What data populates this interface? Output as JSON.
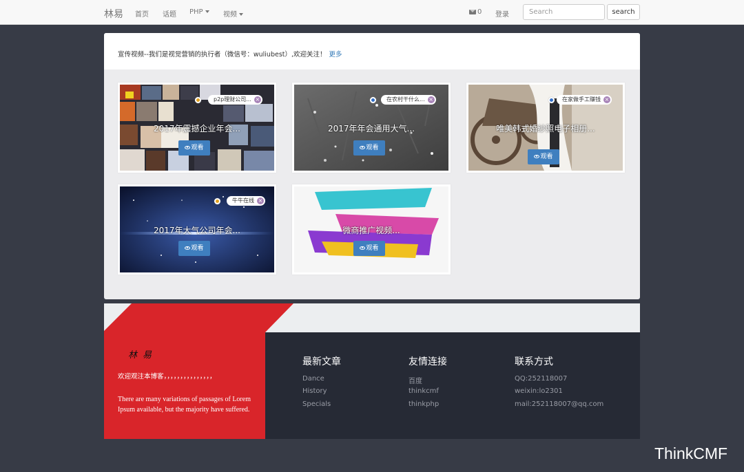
{
  "navbar": {
    "brand": "林易",
    "links": [
      {
        "label": "首页"
      },
      {
        "label": "话题"
      },
      {
        "label": "PHP"
      },
      {
        "label": "视频"
      }
    ],
    "mail_count": "0",
    "login": "登录",
    "search_placeholder": "Search",
    "search_button": "search"
  },
  "intro": {
    "text": "宣传视频--我们是视觉营销的执行者（微信号：wuliubest）,欢迎关注！",
    "more": "更多"
  },
  "videos": [
    {
      "title": "2017年震撼企业年会...",
      "tag": "p2p理财公司...",
      "button": "观看"
    },
    {
      "title": "2017年年会通用大气...",
      "tag": "在农村干什么...",
      "button": "观看"
    },
    {
      "title": "唯美韩式婚纱照电子相册...",
      "tag": "在家做手工赚钱",
      "button": "观看"
    },
    {
      "title": "2017年大气公司年会...",
      "tag": "牛牛在线",
      "button": "观看"
    },
    {
      "title": "微商推广视频...",
      "button": "观看"
    }
  ],
  "footer": {
    "signature": "林易",
    "welcome": "欢迎观注本博客，，，，，，，，，，，，，，，",
    "lorem": "There are many variations of passages of Lorem Ipsum available, but the majority have suffered.",
    "columns": [
      {
        "title": "最新文章",
        "items": [
          "Dance",
          "History",
          "Specials"
        ]
      },
      {
        "title": "友情连接",
        "items": [
          "百度",
          "thinkcmf",
          "thinkphp"
        ]
      },
      {
        "title": "联系方式",
        "items": [
          "QQ:252118007",
          "weixin:lo2301",
          "mail:252118007@qq.com"
        ]
      }
    ],
    "accent_red": "#d9252a"
  },
  "watermark": "ThinkCMF"
}
